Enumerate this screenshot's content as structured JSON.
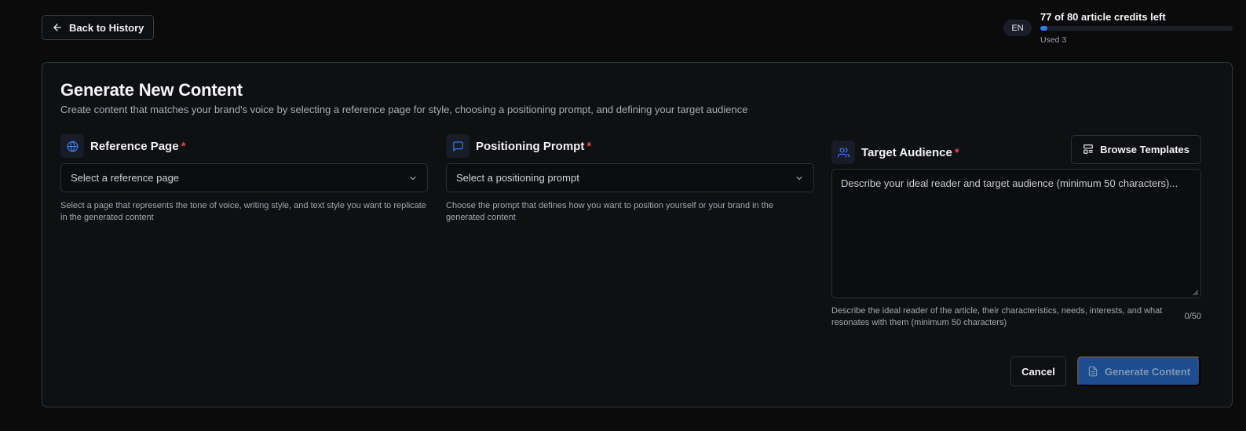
{
  "header": {
    "back_label": "Back to History",
    "language": "EN",
    "credits_title": "77 of 80 article credits left",
    "credits_used": "Used 3",
    "credits_used_fraction": 0.0375,
    "accent_color": "#2f80ed"
  },
  "form": {
    "title": "Generate New Content",
    "subtitle": "Create content that matches your brand's voice by selecting a reference page for style, choosing a positioning prompt, and defining your target audience",
    "reference": {
      "icon": "globe-icon",
      "label": "Reference Page",
      "required_mark": "*",
      "placeholder": "Select a reference page",
      "help": "Select a page that represents the tone of voice, writing style, and text style you want to replicate in the generated content"
    },
    "positioning": {
      "icon": "message-icon",
      "label": "Positioning Prompt",
      "required_mark": "*",
      "placeholder": "Select a positioning prompt",
      "help": "Choose the prompt that defines how you want to position yourself or your brand in the generated content"
    },
    "audience": {
      "icon": "users-icon",
      "label": "Target Audience",
      "required_mark": "*",
      "browse_label": "Browse Templates",
      "placeholder": "Describe your ideal reader and target audience (minimum 50 characters)...",
      "help": "Describe the ideal reader of the article, their characteristics, needs, interests, and what resonates with them (minimum 50 characters)",
      "counter": "0/50"
    },
    "cancel_label": "Cancel",
    "generate_label": "Generate Content"
  }
}
